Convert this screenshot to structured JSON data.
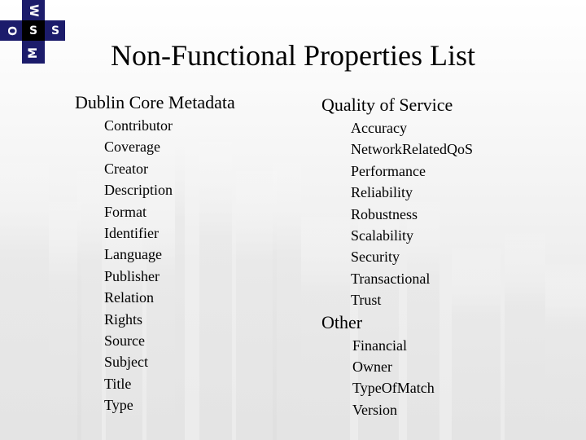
{
  "logo": {
    "letters": {
      "top": "W",
      "left": "O",
      "right": "S",
      "bottom": "M",
      "center": "S"
    },
    "color": "#1c1c6b"
  },
  "title": "Non-Functional Properties List",
  "columns": [
    {
      "sections": [
        {
          "heading": "Dublin Core Metadata",
          "items": [
            "Contributor",
            "Coverage",
            "Creator",
            "Description",
            "Format",
            "Identifier",
            "Language",
            "Publisher",
            "Relation",
            "Rights",
            "Source",
            "Subject",
            "Title",
            "Type"
          ]
        }
      ]
    },
    {
      "sections": [
        {
          "heading": "Quality of Service",
          "items": [
            "Accuracy",
            "NetworkRelatedQoS",
            "Performance",
            "Reliability",
            "Robustness",
            "Scalability",
            "Security",
            "Transactional",
            "Trust"
          ]
        },
        {
          "heading": "Other",
          "items": [
            "Financial",
            "Owner",
            "TypeOfMatch",
            "Version"
          ]
        }
      ]
    }
  ]
}
